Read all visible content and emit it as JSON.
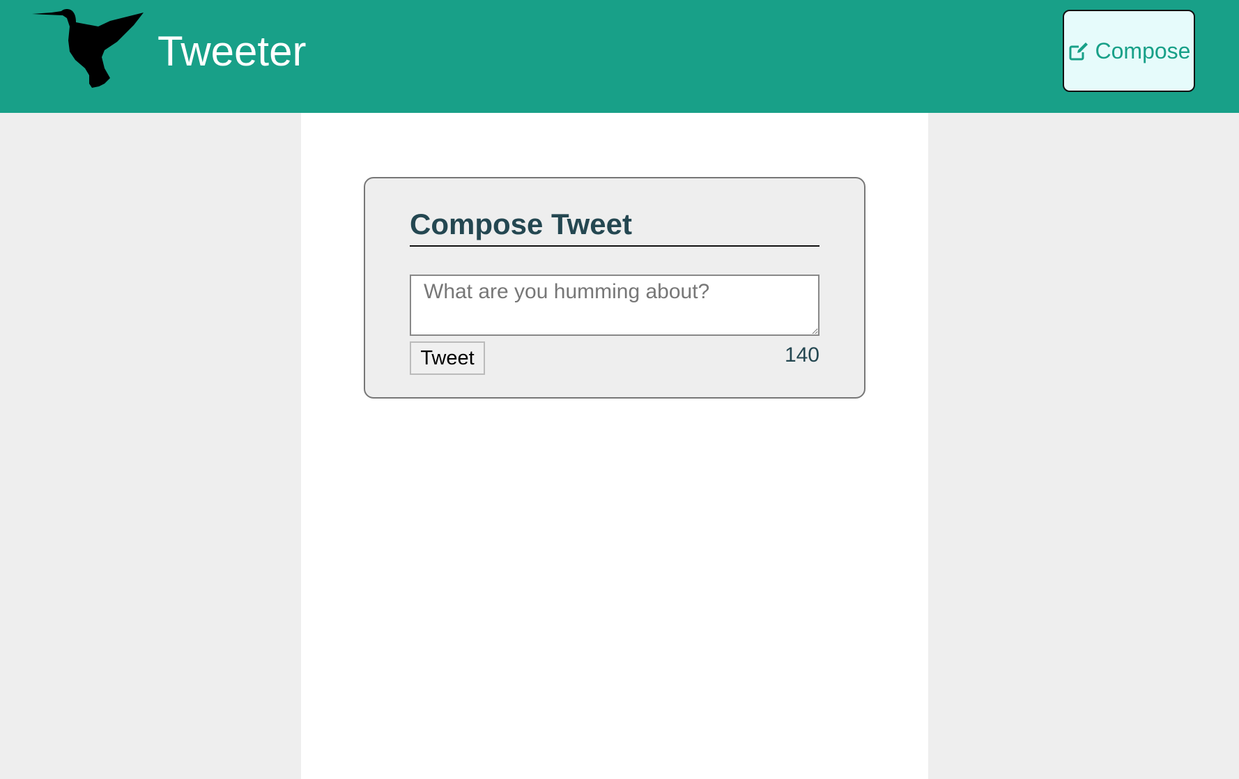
{
  "nav": {
    "brand": "Tweeter",
    "compose_label": "Compose",
    "logo_icon": "hummingbird-icon",
    "compose_icon": "edit-icon",
    "background_color": "#18a088"
  },
  "composer": {
    "title": "Compose Tweet",
    "placeholder": "What are you humming about?",
    "submit_label": "Tweet",
    "char_counter": "140"
  },
  "colors": {
    "accent": "#18a088",
    "heading": "#244751",
    "compose_button_bg": "#e6fbfb",
    "page_bg": "#eeeeee",
    "card_bg": "#eeeeee"
  }
}
